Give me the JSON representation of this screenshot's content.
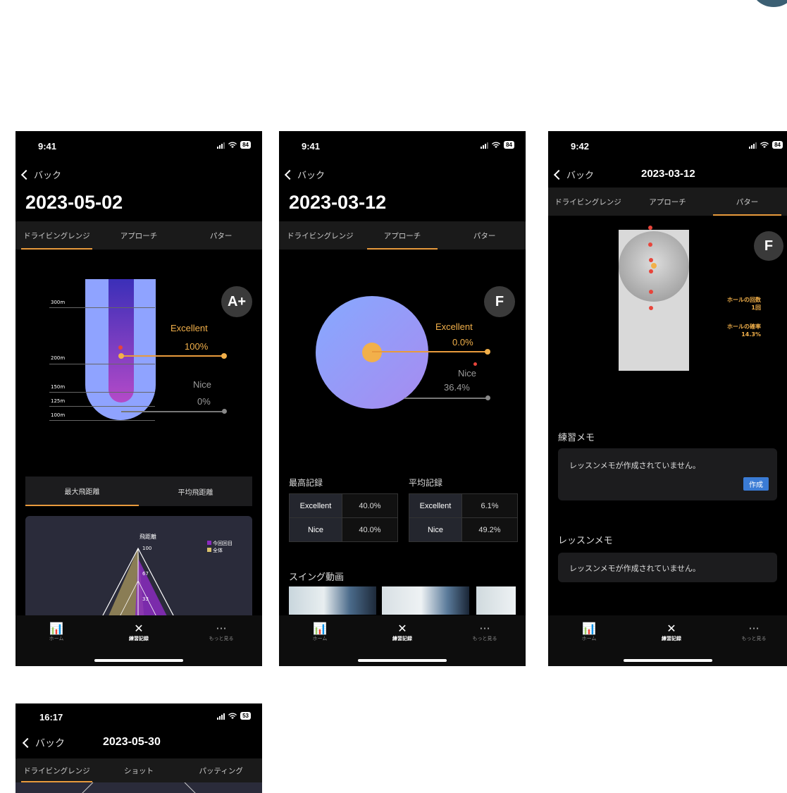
{
  "common": {
    "back_label": "バック",
    "tab_driving": "ドライビングレンジ",
    "tab_approach": "アプローチ",
    "tab_putter": "パター",
    "nav_home": "ホーム",
    "nav_record": "練習記録",
    "nav_more": "もっと見る",
    "icons": {
      "home": "chart-icon",
      "record": "golf-clubs-icon",
      "more": "ellipsis-icon"
    }
  },
  "screen1": {
    "time": "9:41",
    "battery": "84",
    "title": "2023-05-02",
    "grade": "A+",
    "excellent_label": "Excellent",
    "excellent_value": "100%",
    "nice_label": "Nice",
    "nice_value": "0%",
    "distance_marks": [
      "300m",
      "200m",
      "150m",
      "125m",
      "100m"
    ],
    "subtab_max": "最大飛距離",
    "subtab_avg": "平均飛距離",
    "radar_label": "飛距離",
    "radar_ticks": [
      "100",
      "67",
      "33"
    ],
    "legend_current": "今回回目",
    "legend_all": "全体"
  },
  "screen2": {
    "time": "9:41",
    "battery": "84",
    "title": "2023-03-12",
    "grade": "F",
    "excellent_label": "Excellent",
    "excellent_value": "0.0%",
    "nice_label": "Nice",
    "nice_value": "36.4%",
    "best_title": "最高記録",
    "avg_title": "平均記録",
    "best": [
      {
        "k": "Excellent",
        "v": "40.0%"
      },
      {
        "k": "Nice",
        "v": "40.0%"
      }
    ],
    "avg": [
      {
        "k": "Excellent",
        "v": "6.1%"
      },
      {
        "k": "Nice",
        "v": "49.2%"
      }
    ],
    "swing_title": "スイング動画"
  },
  "screen3": {
    "time": "9:42",
    "battery": "84",
    "title": "2023-03-12",
    "grade": "F",
    "hole_count_label": "ホールの回数",
    "hole_count_value": "1回",
    "hole_rate_label": "ホールの確率",
    "hole_rate_value": "14.3%",
    "practice_memo_title": "練習メモ",
    "practice_memo_empty": "レッスンメモが作成されていません。",
    "create_button": "作成",
    "lesson_memo_title": "レッスンメモ",
    "lesson_memo_empty": "レッスンメモが作成されていません。"
  },
  "screen4": {
    "time": "16:17",
    "battery": "53",
    "title": "2023-05-30",
    "tab_driving": "ドライビングレンジ",
    "tab_shot": "ショット",
    "tab_putting": "パッティング"
  },
  "colors": {
    "accent": "#e89a3c",
    "label_orange": "#f2b04a",
    "range_blue": "#8fa3ff",
    "grade_bg": "#3a3a3a",
    "button_blue": "#3a7bd5"
  }
}
